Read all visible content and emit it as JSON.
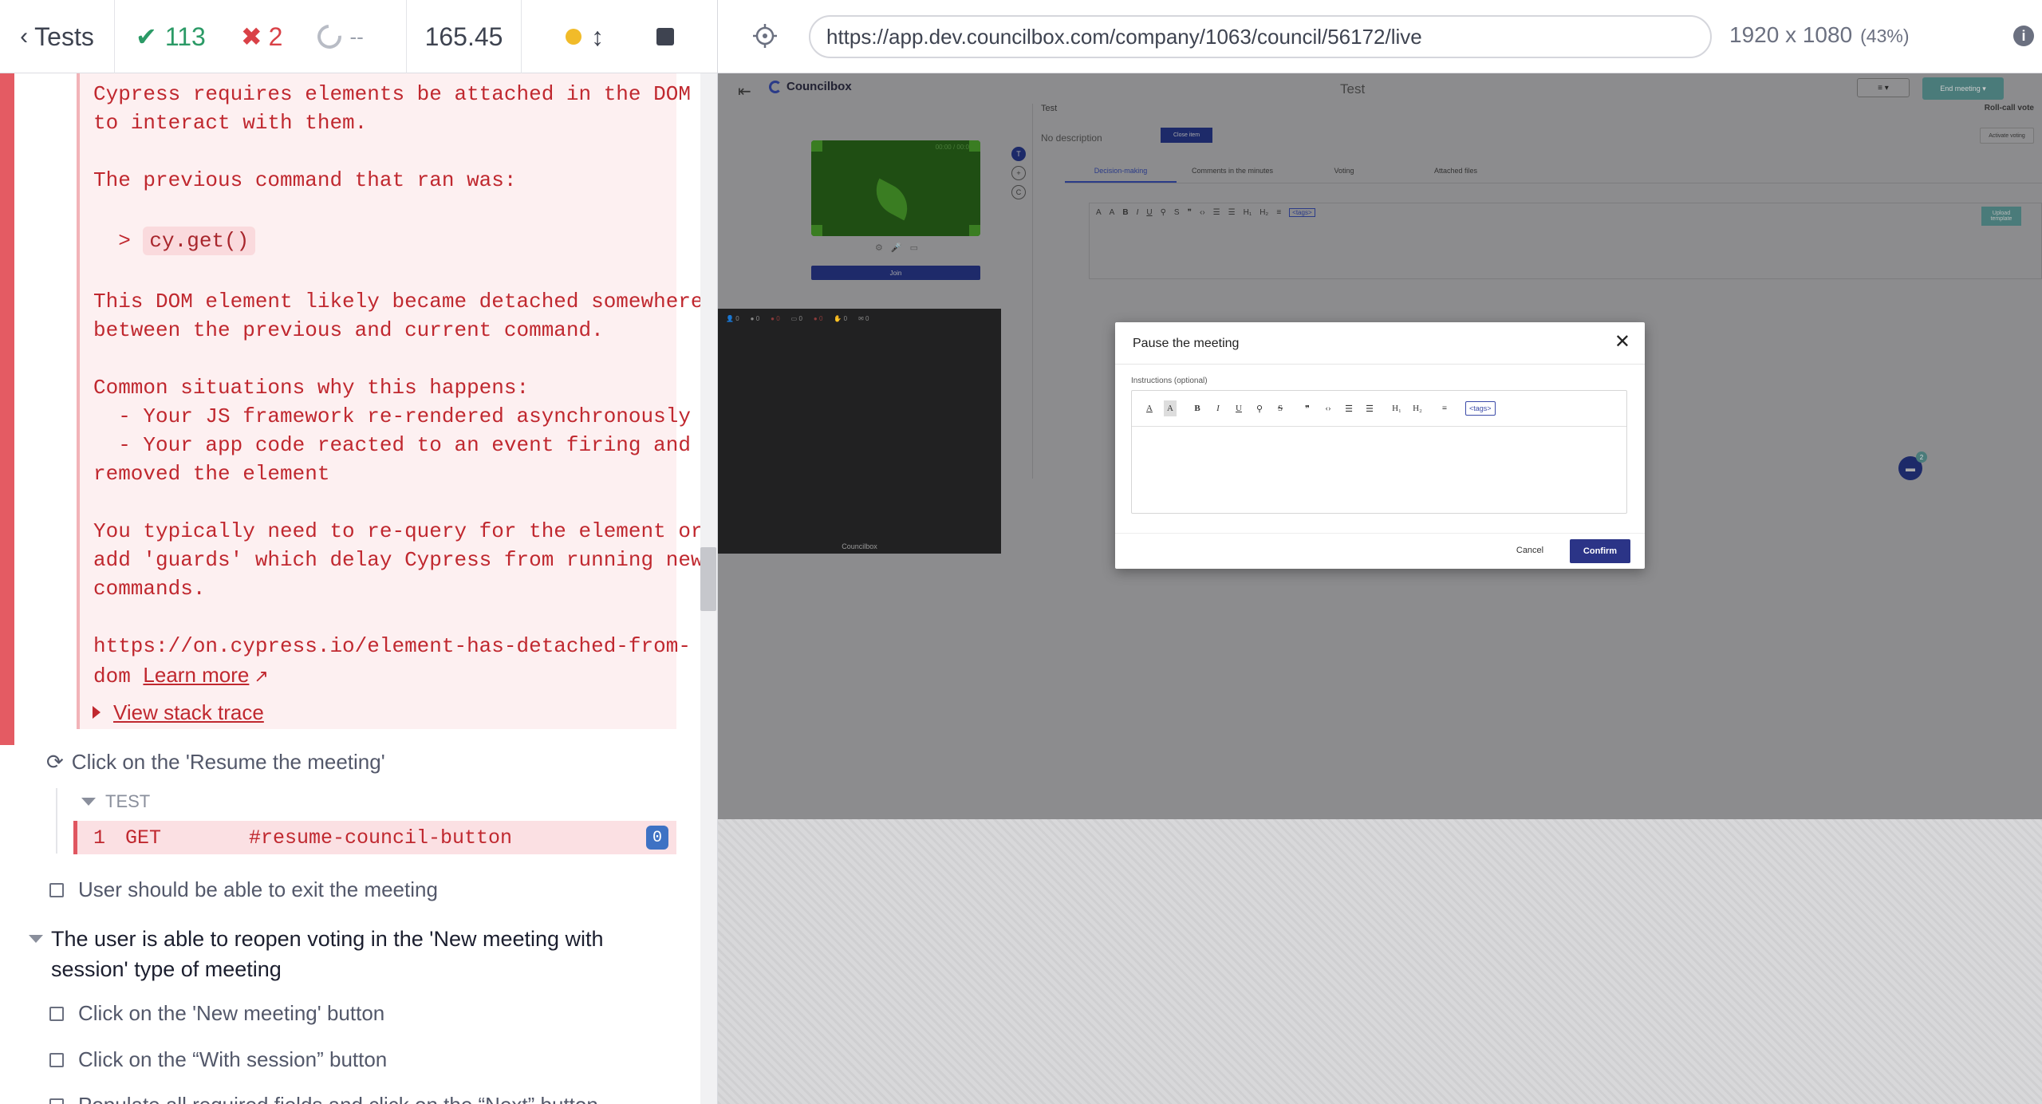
{
  "reporter": {
    "back_label": "Tests",
    "passed": "113",
    "failed": "2",
    "pending": "--",
    "duration": "165.45",
    "error_lines": [
      "Cypress requires elements be attached in the DOM",
      "to interact with them.",
      "",
      "The previous command that ran was:",
      "",
      "  > ",
      "",
      "This DOM element likely became detached somewhere",
      "between the previous and current command.",
      "",
      "Common situations why this happens:",
      "  - Your JS framework re-rendered asynchronously",
      "  - Your app code reacted to an event firing and",
      "removed the element",
      "",
      "You typically need to re-query for the element or",
      "add 'guards' which delay Cypress from running new",
      "commands.",
      "",
      "https://on.cypress.io/element-has-detached-from-",
      "dom "
    ],
    "code_chip": "cy.get()",
    "learn_more": "Learn more",
    "view_stack_trace": "View stack trace",
    "running_step": "Click on the 'Resume the meeting'",
    "test_label": "TEST",
    "command": {
      "number": "1",
      "name": "GET",
      "selector": "#resume-council-button",
      "badge": "0"
    },
    "step_exit": "User should be able to exit the meeting",
    "suite_title": "The user is able to reopen voting in the 'New meeting with session' type of meeting",
    "step_new_meeting": "Click on the 'New meeting' button",
    "step_with_session": "Click on the “With session” button",
    "step_partial": "Populate all required fields and click on the “Next” button"
  },
  "browser": {
    "url": "https://app.dev.councilbox.com/company/1063/council/56172/live",
    "viewport": "1920 x 1080",
    "scale": "(43%)"
  },
  "app": {
    "logo": "Councilbox",
    "title": "Test",
    "menu_btn": "≡ ▾",
    "end_meeting": "End meeting ▾",
    "video_time": "00:00 / 00:0",
    "join": "Join",
    "part_stats": [
      "0",
      "0",
      "0",
      "0",
      "0",
      "0",
      "0"
    ],
    "footer_logo": "Councilbox",
    "side_icons": [
      "T",
      "+",
      "C"
    ],
    "agenda_title": "Test",
    "no_description": "No description",
    "close_item": "Close item",
    "roll_call": "Roll-call vote",
    "activate_voting": "Activate voting",
    "tabs": [
      "Decision-making",
      "Comments in the minutes",
      "Voting",
      "Attached files"
    ],
    "upload_template": "Upload template",
    "chat_badge": "2"
  },
  "modal": {
    "title": "Pause the meeting",
    "instructions_label": "Instructions (optional)",
    "toolbar": [
      "A",
      "A",
      "B",
      "I",
      "U",
      "⚲",
      "S",
      "❞",
      "‹›",
      "☰",
      "☰",
      "H₁",
      "H₂",
      "≡"
    ],
    "tags": "<tags>",
    "cancel": "Cancel",
    "confirm": "Confirm"
  },
  "colors": {
    "pass": "#2b9a66",
    "fail": "#d94147",
    "error_text": "#c0282f",
    "confirm": "#2b3487"
  }
}
